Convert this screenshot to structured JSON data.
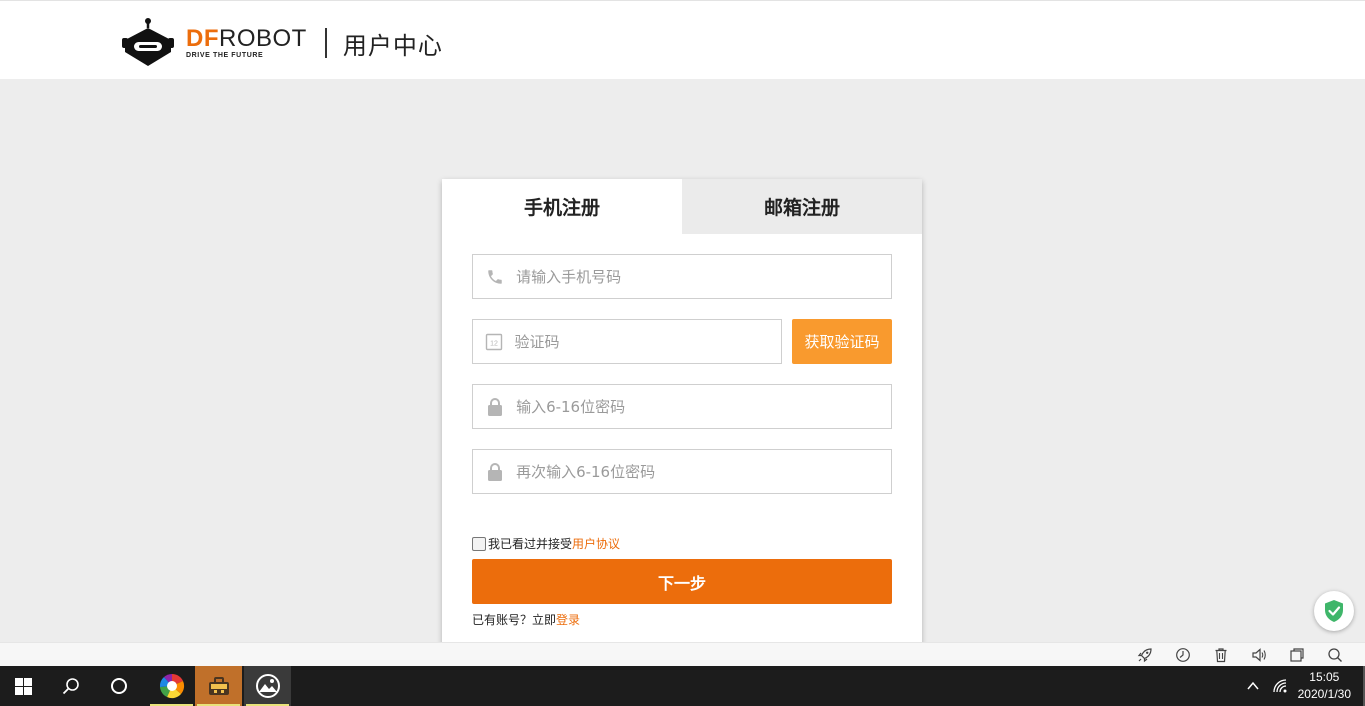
{
  "header": {
    "logo_df": "DF",
    "logo_robot": "ROBOT",
    "logo_slogan": "DRIVE THE FUTURE",
    "title": "用户中心"
  },
  "tabs": [
    {
      "label": "手机注册",
      "active": true
    },
    {
      "label": "邮箱注册",
      "active": false
    }
  ],
  "form": {
    "phone_placeholder": "请输入手机号码",
    "code_placeholder": "验证码",
    "get_code_label": "获取验证码",
    "password_placeholder": "输入6-16位密码",
    "password_confirm_placeholder": "再次输入6-16位密码",
    "agree_text": "我已看过并接受",
    "agree_link": "用户协议",
    "agree_checked": false,
    "next_label": "下一步",
    "have_account_text": "已有账号？立即",
    "login_link": "登录"
  },
  "colors": {
    "brand_orange": "#ec6d0c",
    "get_code_orange": "#f99a2e",
    "page_bg": "#ededed"
  },
  "browser_toolbar": {
    "icons": [
      "rocket-icon",
      "clock-icon",
      "trash-icon",
      "speaker-icon",
      "window-icon",
      "search-icon"
    ]
  },
  "taskbar": {
    "time": "15:05",
    "date": "2020/1/30"
  }
}
